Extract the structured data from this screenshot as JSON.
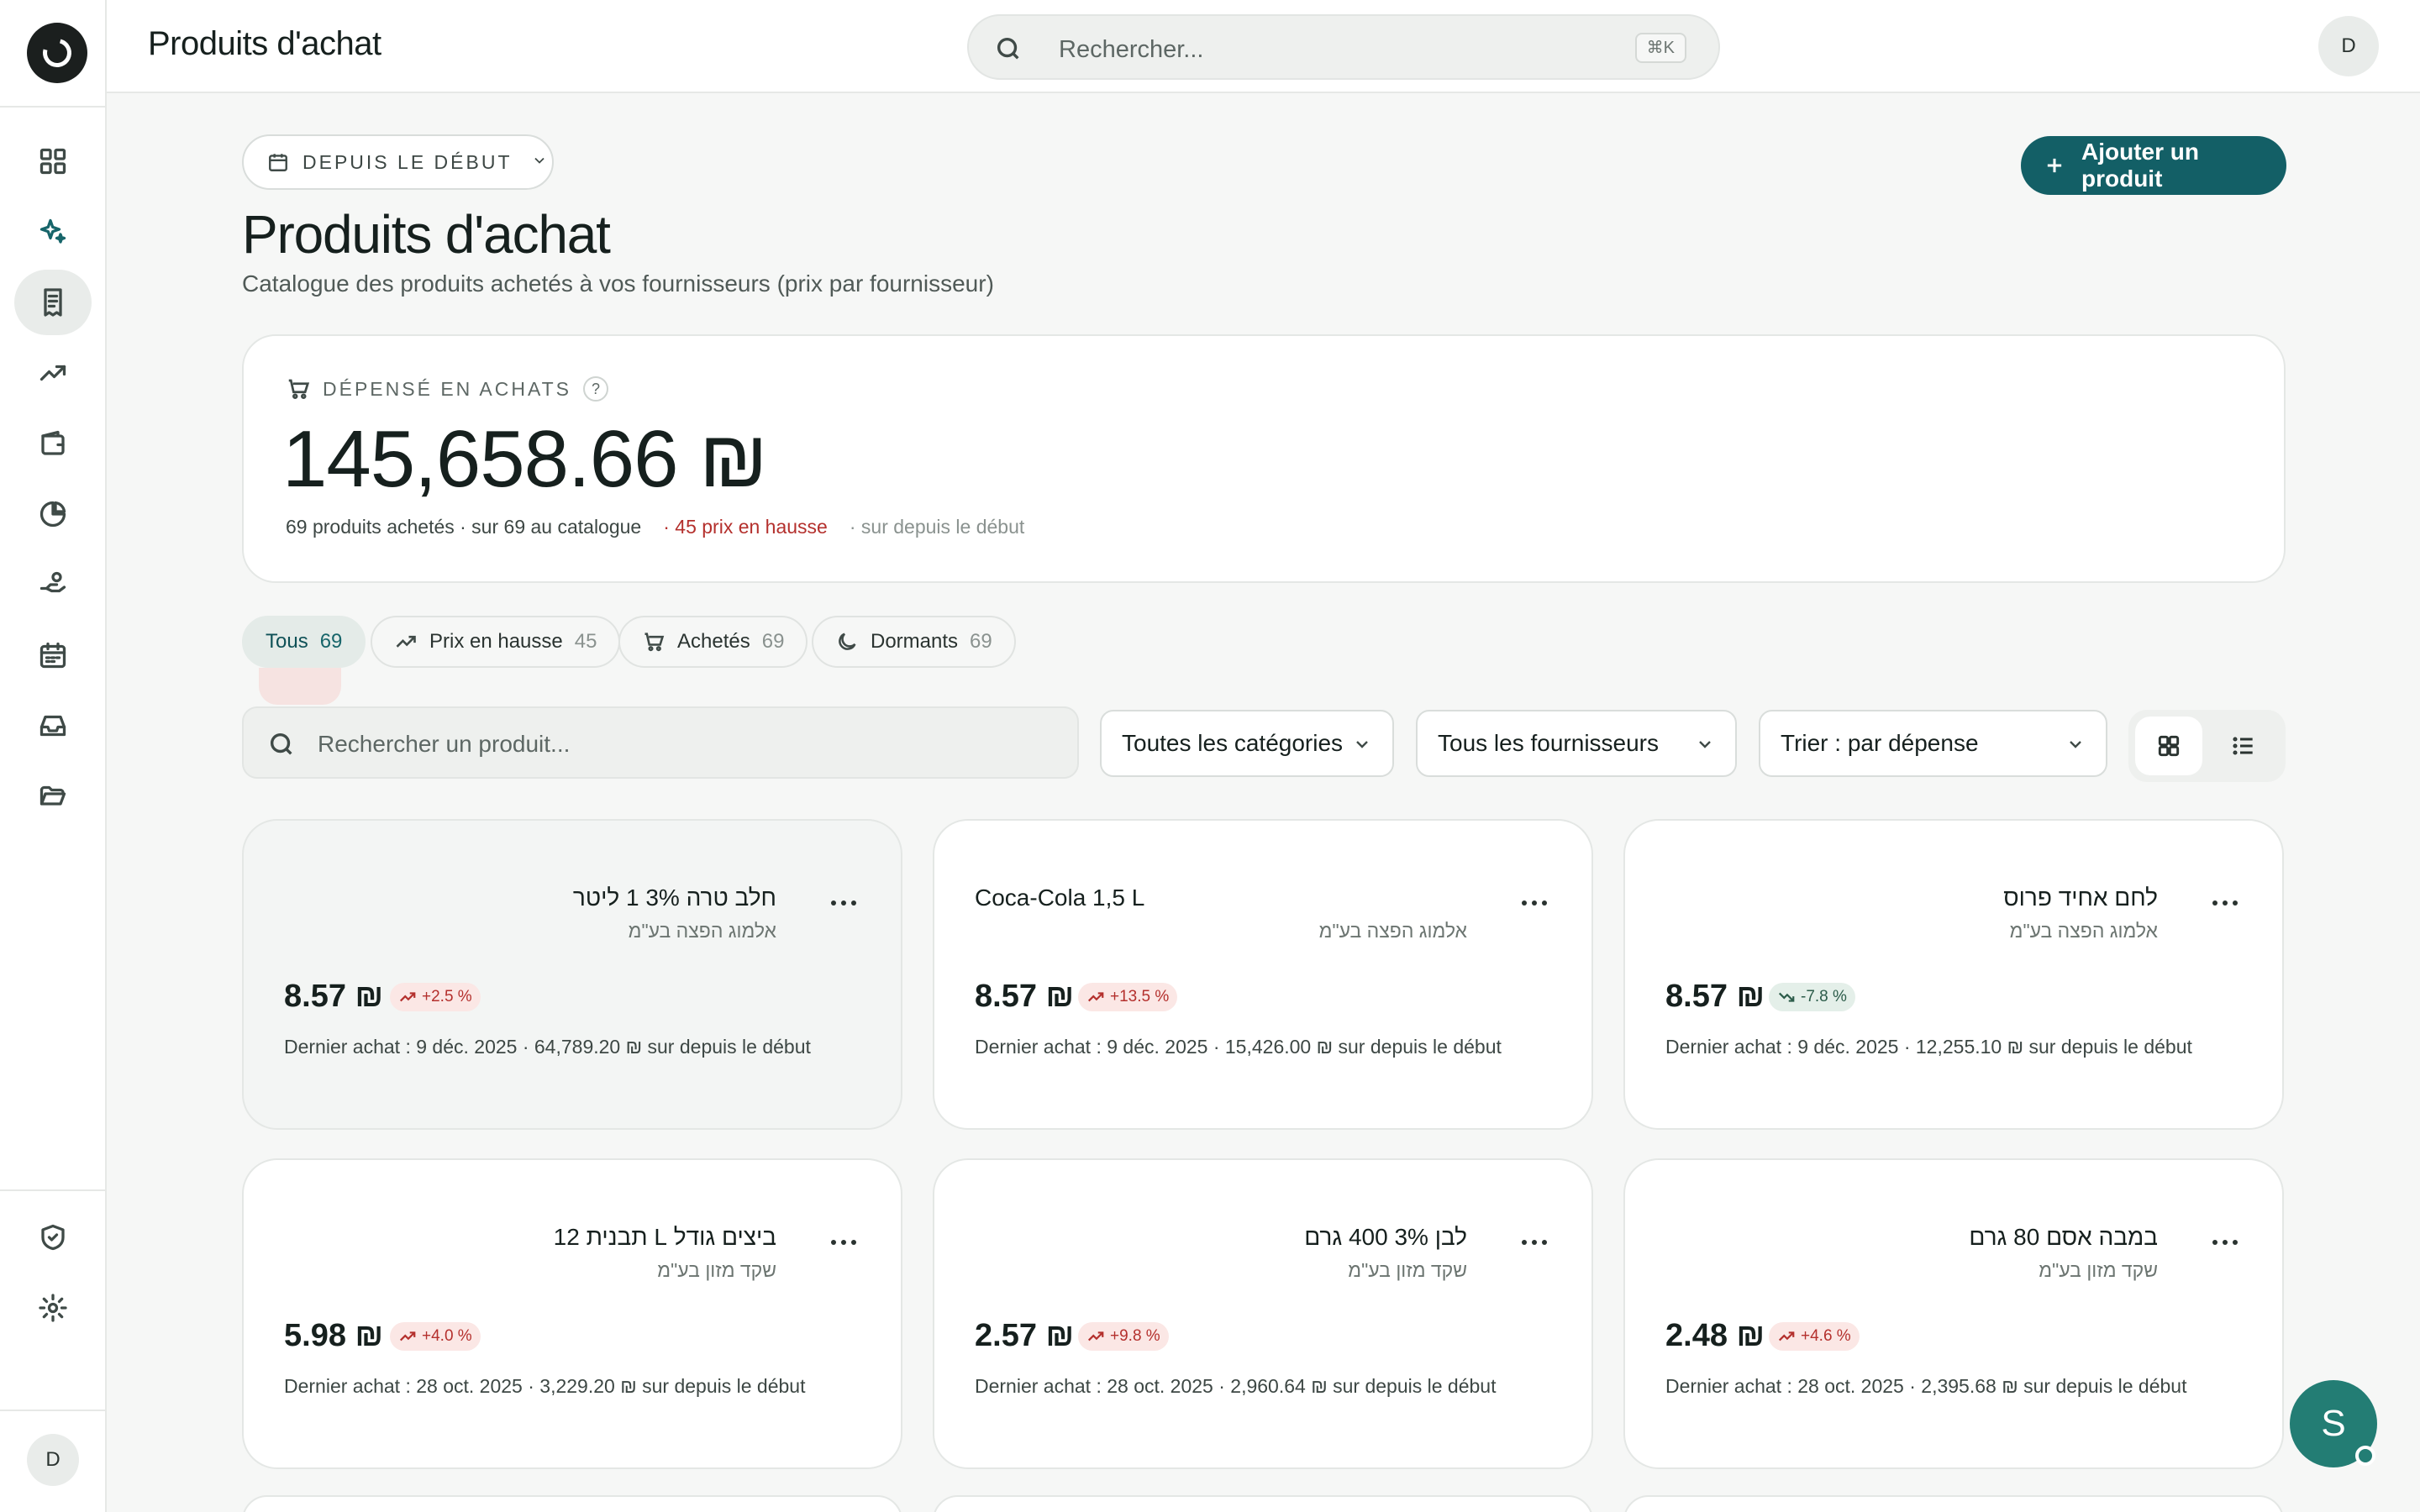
{
  "topbar": {
    "title": "Produits d'achat",
    "search_placeholder": "Rechercher...",
    "shortcut": "⌘K",
    "avatar": "D"
  },
  "sidebar": {
    "avatar": "D",
    "items": [
      {
        "icon": "dashboard-icon"
      },
      {
        "icon": "sparkles-icon"
      },
      {
        "icon": "receipt-icon",
        "active": true
      },
      {
        "icon": "trending-up-icon"
      },
      {
        "icon": "wallet-icon"
      },
      {
        "icon": "pie-chart-icon"
      },
      {
        "icon": "hand-coins-icon"
      },
      {
        "icon": "calendar-icon"
      },
      {
        "icon": "inbox-icon"
      },
      {
        "icon": "folder-open-icon"
      }
    ],
    "bottom_items": [
      {
        "icon": "shield-check-icon"
      },
      {
        "icon": "settings-icon"
      }
    ]
  },
  "header": {
    "period_label": "DEPUIS LE DÉBUT",
    "add_button": "Ajouter un produit",
    "title": "Produits d'achat",
    "subtitle": "Catalogue des produits achetés à vos fournisseurs (prix par fournisseur)"
  },
  "spend": {
    "label": "DÉPENSÉ EN ACHATS",
    "help": "?",
    "amount": "145,658.66 ₪",
    "meta_purchased": "69 produits achetés · sur 69 au catalogue",
    "meta_rising": "· 45 prix en hausse",
    "meta_period": "· sur depuis le début"
  },
  "tabs": [
    {
      "label": "Tous",
      "count": "69",
      "active": true
    },
    {
      "label": "Prix en hausse",
      "count": "45",
      "icon": "trending-up-icon"
    },
    {
      "label": "Achetés",
      "count": "69",
      "icon": "cart-icon"
    },
    {
      "label": "Dormants",
      "count": "69",
      "icon": "moon-icon"
    }
  ],
  "filters": {
    "search_placeholder": "Rechercher un produit...",
    "category": "Toutes les catégories",
    "supplier": "Tous les fournisseurs",
    "sort": "Trier : par dépense"
  },
  "products": [
    {
      "name": "חלב טרה 3% 1 ליטר",
      "supplier": "אלמוג הפצה בע\"מ",
      "price": "8.57 ₪",
      "change": "+2.5 %",
      "trend": "up",
      "detail": "Dernier achat : 9 déc. 2025 · 64,789.20 ₪ sur depuis le début",
      "rtl": true
    },
    {
      "name": "Coca-Cola 1,5 L",
      "supplier": "אלמוג הפצה בע\"מ",
      "price": "8.57 ₪",
      "change": "+13.5 %",
      "trend": "up",
      "detail": "Dernier achat : 9 déc. 2025 · 15,426.00 ₪ sur depuis le début",
      "rtl": false
    },
    {
      "name": "לחם אחיד פרוס",
      "supplier": "אלמוג הפצה בע\"מ",
      "price": "8.57 ₪",
      "change": "-7.8 %",
      "trend": "down",
      "detail": "Dernier achat : 9 déc. 2025 · 12,255.10 ₪ sur depuis le début",
      "rtl": true
    },
    {
      "name": "ביצים גודל L תבנית 12",
      "supplier": "שקד מזון בע\"מ",
      "price": "5.98 ₪",
      "change": "+4.0 %",
      "trend": "up",
      "detail": "Dernier achat : 28 oct. 2025 · 3,229.20 ₪ sur depuis le début",
      "rtl": true
    },
    {
      "name": "לבן 3% 400 גרם",
      "supplier": "שקד מזון בע\"מ",
      "price": "2.57 ₪",
      "change": "+9.8 %",
      "trend": "up",
      "detail": "Dernier achat : 28 oct. 2025 · 2,960.64 ₪ sur depuis le début",
      "rtl": true
    },
    {
      "name": "במבה אסם 80 גרם",
      "supplier": "שקד מזון בע\"מ",
      "price": "2.48 ₪",
      "change": "+4.6 %",
      "trend": "up",
      "detail": "Dernier achat : 28 oct. 2025 · 2,395.68 ₪ sur depuis le début",
      "rtl": true
    }
  ],
  "chat": {
    "initial": "S"
  },
  "colors": {
    "accent": "#135f66",
    "rising": "#b4302d",
    "falling": "#2c5c4a"
  }
}
